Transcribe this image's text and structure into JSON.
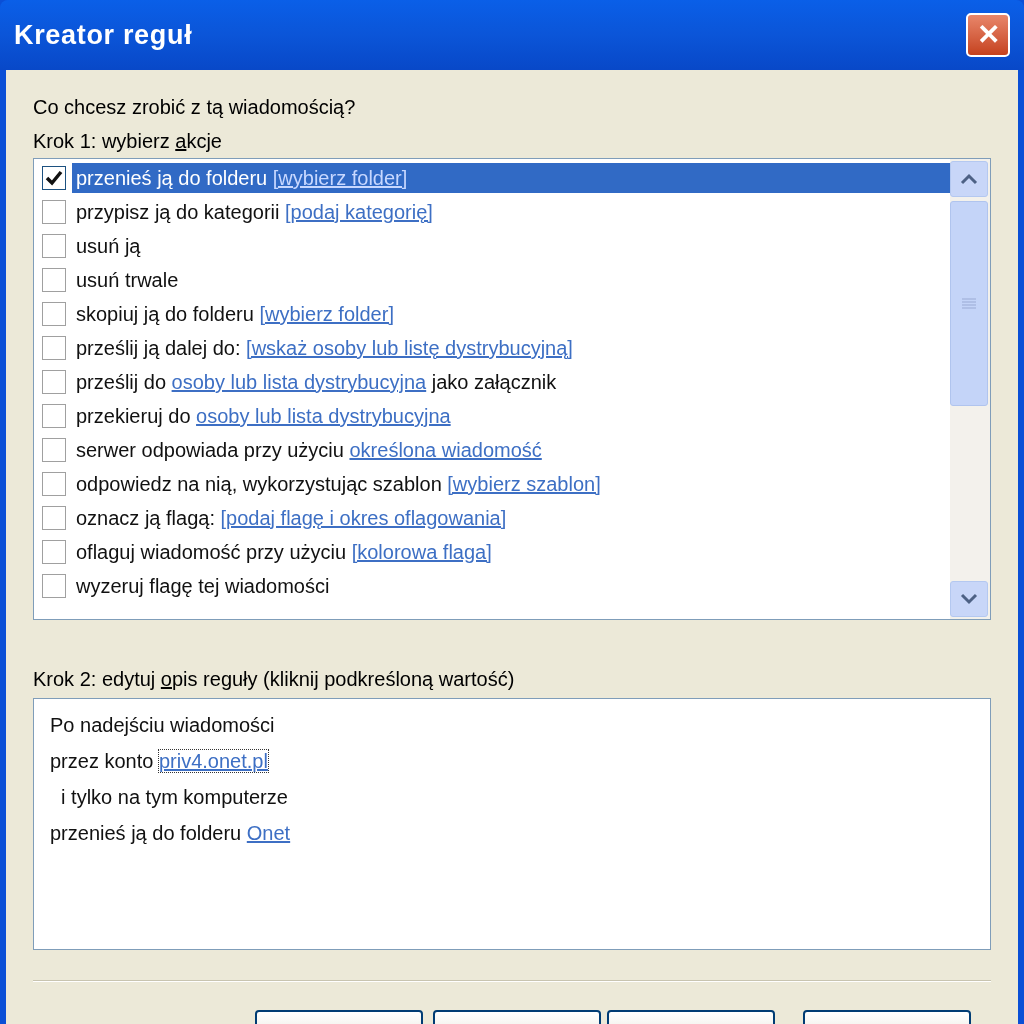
{
  "window": {
    "title": "Kreator reguł",
    "close": "✕"
  },
  "question": "Co chcesz zrobić z tą wiadomością?",
  "step1": {
    "label": {
      "before": "Krok 1: wybierz ",
      "key": "a",
      "after": "kcje"
    },
    "actions": [
      {
        "checked": true,
        "selected": true,
        "parts": [
          {
            "kind": "text",
            "text": "przenieś ją do folderu "
          },
          {
            "kind": "link",
            "text": "[wybierz folder]"
          }
        ]
      },
      {
        "checked": false,
        "selected": false,
        "parts": [
          {
            "kind": "text",
            "text": "przypisz ją do kategorii "
          },
          {
            "kind": "link",
            "text": "[podaj kategorię]"
          }
        ]
      },
      {
        "checked": false,
        "selected": false,
        "parts": [
          {
            "kind": "text",
            "text": "usuń ją"
          }
        ]
      },
      {
        "checked": false,
        "selected": false,
        "parts": [
          {
            "kind": "text",
            "text": "usuń trwale"
          }
        ]
      },
      {
        "checked": false,
        "selected": false,
        "parts": [
          {
            "kind": "text",
            "text": "skopiuj ją do folderu "
          },
          {
            "kind": "link",
            "text": "[wybierz folder]"
          }
        ]
      },
      {
        "checked": false,
        "selected": false,
        "parts": [
          {
            "kind": "text",
            "text": "prześlij ją dalej do: "
          },
          {
            "kind": "link",
            "text": "[wskaż osoby lub listę dystrybucyjną]"
          }
        ]
      },
      {
        "checked": false,
        "selected": false,
        "parts": [
          {
            "kind": "text",
            "text": "prześlij do "
          },
          {
            "kind": "link",
            "text": "osoby lub lista dystrybucyjna"
          },
          {
            "kind": "text",
            "text": " jako załącznik"
          }
        ]
      },
      {
        "checked": false,
        "selected": false,
        "parts": [
          {
            "kind": "text",
            "text": "przekieruj do "
          },
          {
            "kind": "link",
            "text": "osoby lub lista dystrybucyjna"
          }
        ]
      },
      {
        "checked": false,
        "selected": false,
        "parts": [
          {
            "kind": "text",
            "text": "serwer odpowiada przy użyciu "
          },
          {
            "kind": "link",
            "text": "określona wiadomość"
          }
        ]
      },
      {
        "checked": false,
        "selected": false,
        "parts": [
          {
            "kind": "text",
            "text": "odpowiedz na nią, wykorzystując szablon "
          },
          {
            "kind": "link",
            "text": "[wybierz szablon]"
          }
        ]
      },
      {
        "checked": false,
        "selected": false,
        "parts": [
          {
            "kind": "text",
            "text": "oznacz ją flagą: "
          },
          {
            "kind": "link",
            "text": "[podaj flagę i okres oflagowania]"
          }
        ]
      },
      {
        "checked": false,
        "selected": false,
        "parts": [
          {
            "kind": "text",
            "text": "oflaguj wiadomość przy użyciu "
          },
          {
            "kind": "link",
            "text": "[kolorowa flaga]"
          }
        ]
      },
      {
        "checked": false,
        "selected": false,
        "parts": [
          {
            "kind": "text",
            "text": "wyzeruj flagę tej wiadomości"
          }
        ]
      }
    ]
  },
  "step2": {
    "label": {
      "before": "Krok 2: edytuj ",
      "key": "o",
      "after": "pis reguły (kliknij podkreśloną wartość)"
    },
    "lines": [
      {
        "parts": [
          {
            "kind": "text",
            "text": "Po nadejściu wiadomości"
          }
        ]
      },
      {
        "parts": [
          {
            "kind": "text",
            "text": "przez konto "
          },
          {
            "kind": "link",
            "text": "priv4.onet.pl",
            "focused": true
          }
        ]
      },
      {
        "parts": [
          {
            "kind": "text",
            "text": "  i tylko na tym komputerze"
          }
        ]
      },
      {
        "parts": [
          {
            "kind": "text",
            "text": "przenieś ją do folderu "
          },
          {
            "kind": "link",
            "text": "Onet",
            "focused": false
          }
        ]
      }
    ]
  },
  "buttons": [
    {
      "kind": "blank"
    },
    {
      "kind": "blank"
    },
    {
      "kind": "blank"
    },
    {
      "kind": "blank"
    }
  ]
}
